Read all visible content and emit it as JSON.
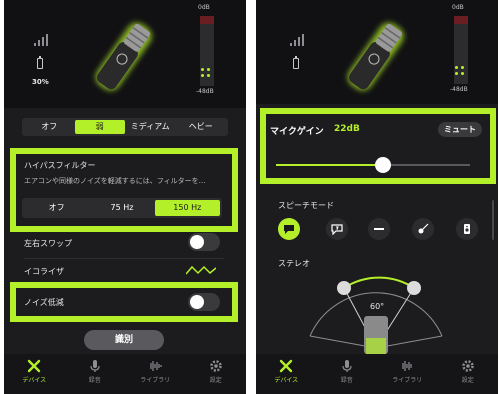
{
  "colors": {
    "accent": "#b4f02a",
    "background": "#1c1c1e",
    "peak": "#6b1e22"
  },
  "left": {
    "battery_percent": "30%",
    "meter_top": "0dB",
    "meter_bottom": "-48dB",
    "meter_level": 0.15,
    "signal_bars": 4,
    "filter_segment": {
      "options": [
        "オフ",
        "弱",
        "ミディアム",
        "ヘビー"
      ],
      "selected": "弱"
    },
    "highpass": {
      "title": "ハイパスフィルター",
      "description": "エアコンや同様のノイズを軽減するには、フィルターを…",
      "options": [
        "オフ",
        "75 Hz",
        "150 Hz"
      ],
      "selected": "150 Hz"
    },
    "lr_swap_label": "左右スワップ",
    "lr_swap_on": false,
    "eq_label": "イコライザ",
    "noise_label": "ノイズ低減",
    "noise_on": false,
    "identify_label": "識別"
  },
  "right": {
    "meter_top": "0dB",
    "meter_bottom": "-48dB",
    "meter_level": 0.15,
    "gain_label": "マイクゲイン",
    "gain_value": "22dB",
    "gain_fraction": 0.55,
    "mute_label": "ミュート",
    "speech_mode_label": "スピーチモード",
    "speech_modes": [
      "speech-bubble-icon",
      "speech-bubble-alt-icon",
      "flat-line-icon",
      "guitar-icon",
      "speaker-icon"
    ],
    "speech_selected": "speech-bubble-icon",
    "stereo_label": "ステレオ",
    "stereo_angle": "60°"
  },
  "tabs": [
    {
      "label": "デバイス",
      "icon": "tools-icon",
      "active": true
    },
    {
      "label": "録音",
      "icon": "microphone-icon",
      "active": false
    },
    {
      "label": "ライブラリ",
      "icon": "waveform-icon",
      "active": false
    },
    {
      "label": "設定",
      "icon": "gear-icon",
      "active": false
    }
  ]
}
